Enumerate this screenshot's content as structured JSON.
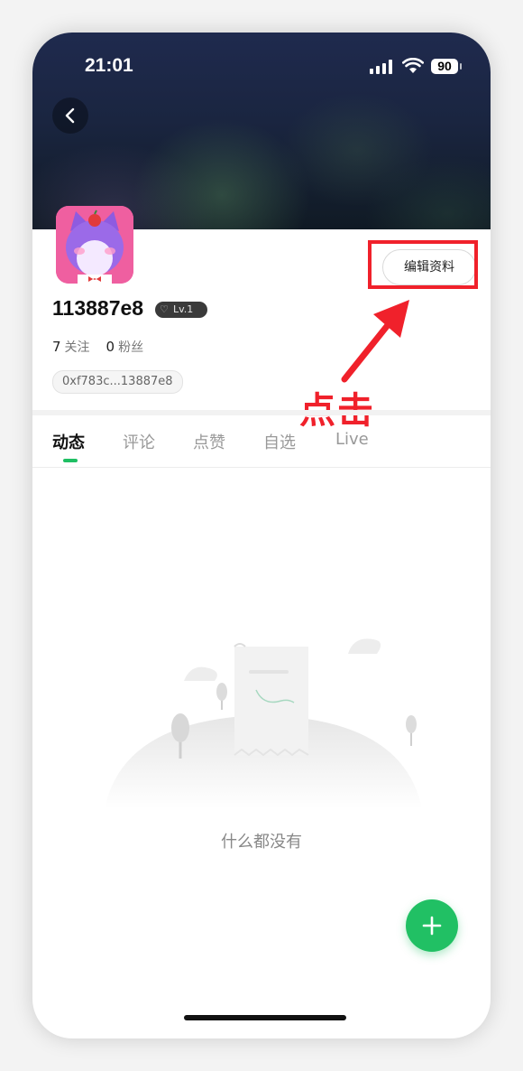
{
  "status_bar": {
    "time": "21:01",
    "battery": "90"
  },
  "profile": {
    "username": "113887e8",
    "level": "Lv.1",
    "following_count": "7",
    "following_label": "关注",
    "followers_count": "0",
    "followers_label": "粉丝",
    "wallet_address": "0xf783c...13887e8",
    "edit_button_label": "编辑资料"
  },
  "annotation": {
    "click_hint": "点击",
    "color": "#f0212b"
  },
  "tabs": [
    {
      "label": "动态",
      "active": true
    },
    {
      "label": "评论",
      "active": false
    },
    {
      "label": "点赞",
      "active": false
    },
    {
      "label": "自选",
      "active": false
    },
    {
      "label": "Live",
      "active": false
    }
  ],
  "empty_state": {
    "message": "什么都没有"
  },
  "colors": {
    "accent": "#21c064",
    "avatar_bg": "#ef5fa0"
  },
  "icons": [
    "chevron-left-icon",
    "signal-icon",
    "wifi-icon",
    "battery-icon",
    "plus-icon",
    "level-heart-icon"
  ]
}
